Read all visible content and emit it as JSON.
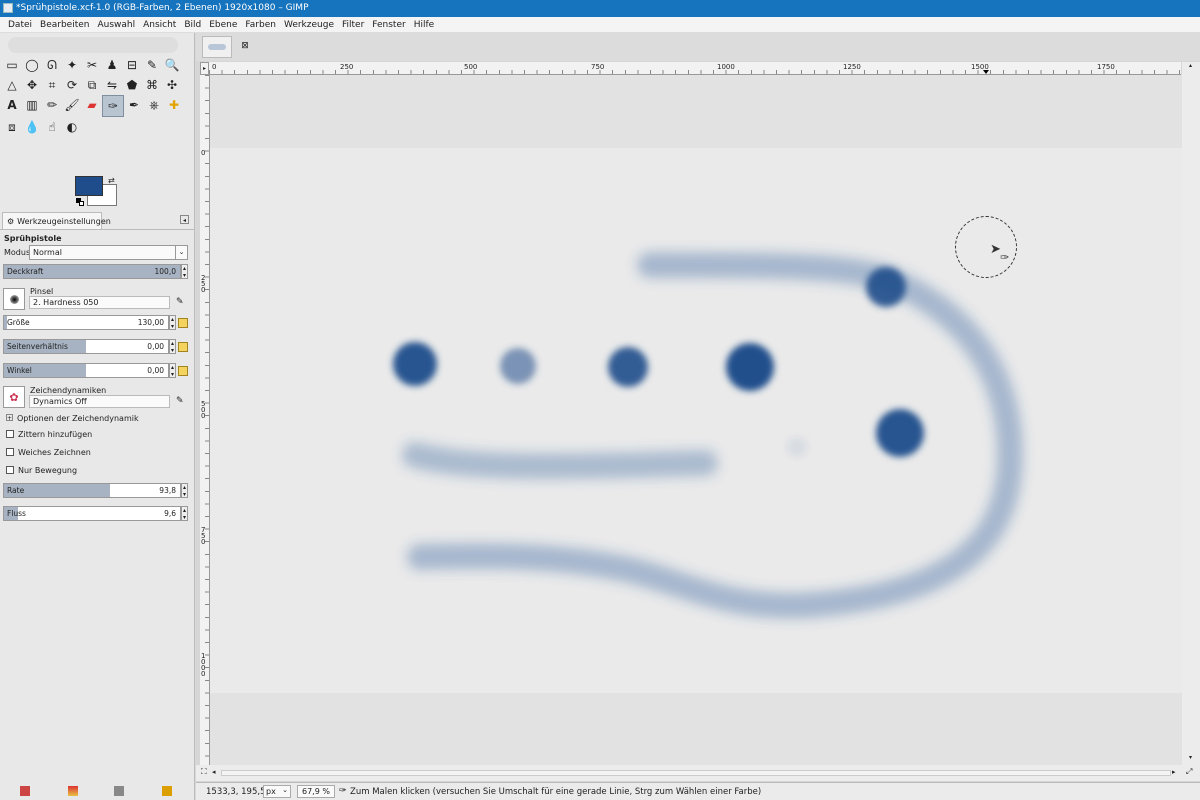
{
  "window": {
    "title": "*Sprühpistole.xcf-1.0 (RGB-Farben, 2 Ebenen) 1920x1080 – GIMP"
  },
  "menu": [
    "Datei",
    "Bearbeiten",
    "Auswahl",
    "Ansicht",
    "Bild",
    "Ebene",
    "Farben",
    "Werkzeuge",
    "Filter",
    "Fenster",
    "Hilfe"
  ],
  "tools": [
    "rect-select-icon",
    "ellipse-select-icon",
    "lasso-icon",
    "fuzzy-select-icon",
    "scissors-icon",
    "foreground-select-icon",
    "align-icon",
    "paths-icon",
    "color-picker-icon",
    "zoom-icon",
    "measure-icon",
    "move-icon",
    "crop-icon",
    "rotate-icon",
    "perspective-icon",
    "flip-icon",
    "cage-icon",
    "warp-icon",
    "text-icon",
    "gradient-icon",
    "pencil-icon",
    "paintbrush-icon",
    "eraser-icon",
    "airbrush-icon",
    "ink-icon",
    "clone-icon",
    "heal-icon",
    "blur-icon",
    "smudge-icon",
    "dodge-icon"
  ],
  "colors": {
    "foreground": "#1f4d8b",
    "background": "#ffffff",
    "accent": "#1673bd",
    "paint": "#2a5b9a"
  },
  "tool_options": {
    "tab_label": "Werkzeugeinstellungen",
    "tool_name": "Sprühpistole",
    "mode_label": "Modus:",
    "mode_value": "Normal",
    "opacity": {
      "label": "Deckkraft",
      "value": "100,0",
      "fraction": 1.0
    },
    "brush": {
      "label": "Pinsel",
      "value": "2. Hardness 050"
    },
    "size": {
      "label": "Größe",
      "value": "130,00",
      "fraction": 0.02
    },
    "aspect": {
      "label": "Seitenverhältnis",
      "value": "0,00",
      "fraction": 0.5
    },
    "angle": {
      "label": "Winkel",
      "value": "0,00",
      "fraction": 0.5
    },
    "dynamics": {
      "label": "Zeichendynamiken",
      "value": "Dynamics Off"
    },
    "dynamics_options": "Optionen der Zeichendynamik",
    "jitter": "Zittern hinzufügen",
    "smooth": "Weiches Zeichnen",
    "motion_only": "Nur Bewegung",
    "rate": {
      "label": "Rate",
      "value": "93,8",
      "fraction": 0.6
    },
    "flow": {
      "label": "Fluss",
      "value": "9,6",
      "fraction": 0.08
    }
  },
  "ruler": {
    "h_ticks": [
      "0",
      "250",
      "500",
      "750",
      "1000",
      "1250",
      "1500",
      "1750"
    ],
    "v_ticks": [
      "0",
      "250",
      "500",
      "750",
      "1000"
    ]
  },
  "status": {
    "coords": "1533,3, 195,5",
    "unit": "px",
    "zoom": "67,9 %",
    "message": "Zum Malen klicken (versuchen Sie Umschalt für eine gerade Linie, Strg zum Wählen einer Farbe)"
  }
}
